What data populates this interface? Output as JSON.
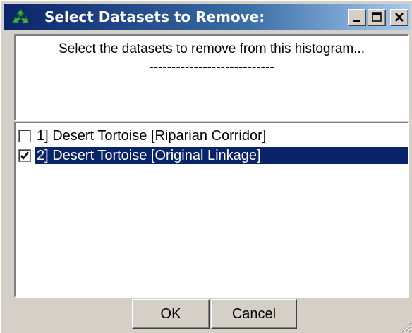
{
  "window": {
    "title": "Select Datasets to Remove:",
    "icon": "recycle-icon",
    "controls": [
      "minimize-icon",
      "maximize-icon",
      "close-icon"
    ]
  },
  "prompt": {
    "line1": "Select the datasets to remove from this histogram...",
    "line2": "----------------------------"
  },
  "datasets": [
    {
      "label": "1] Desert Tortoise [Riparian Corridor]",
      "checked": false,
      "selected": false
    },
    {
      "label": "2] Desert Tortoise [Original Linkage]",
      "checked": true,
      "selected": true
    }
  ],
  "buttons": {
    "ok": "OK",
    "cancel": "Cancel"
  },
  "colors": {
    "titlebar": "#0a246a",
    "selection": "#0a246a",
    "face": "#d4d0c8"
  }
}
